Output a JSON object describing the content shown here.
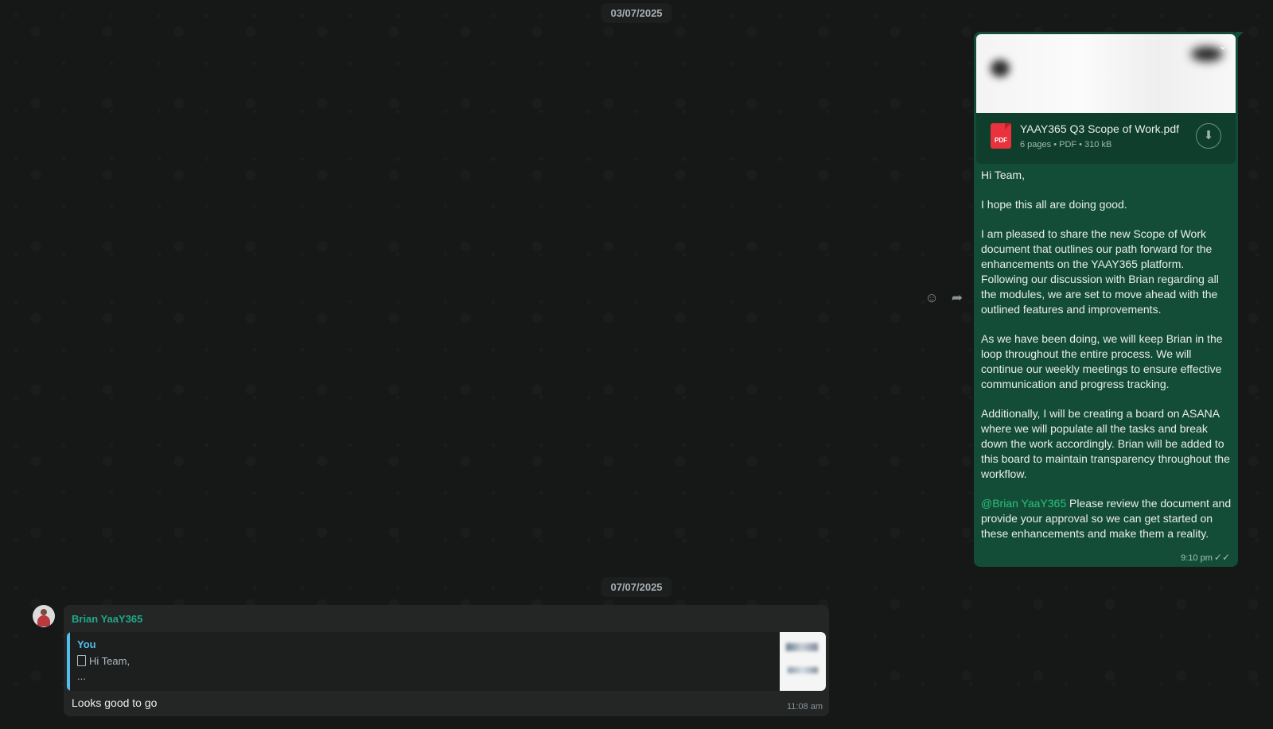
{
  "dates": {
    "first": "03/07/2025",
    "second": "07/07/2025"
  },
  "outgoing": {
    "file": {
      "name": "YAAY365 Q3 Scope of Work.pdf",
      "meta": "6 pages • PDF • 310 kB",
      "type_badge": "PDF"
    },
    "paragraphs": [
      "Hi Team,",
      "I hope this all are doing good.",
      "I am pleased to share the new Scope of Work document that outlines our path forward for the enhancements on the YAAY365 platform. Following our discussion with Brian regarding all the modules, we are set to move ahead with the outlined features and improvements.",
      "As we have been doing, we will keep Brian in the loop throughout the entire process. We will continue our weekly meetings to ensure effective communication and progress tracking.",
      "Additionally, I will be creating a board on ASANA where we will populate all the tasks and break down the work accordingly. Brian will be added to this board to maintain transparency throughout the workflow."
    ],
    "mention": "@Brian YaaY365",
    "last_paragraph": " Please review the document and provide your approval so we can get started on these enhancements and make them a reality.",
    "time": "9:10 pm"
  },
  "incoming": {
    "sender": "Brian YaaY365",
    "quote": {
      "author": "You",
      "line": "Hi Team,",
      "more": "..."
    },
    "text": "Looks good to go",
    "time": "11:08 am"
  },
  "icons": {
    "emoji": "emoji-icon",
    "forward": "forward-icon",
    "download": "download-icon",
    "chevron": "chevron-down-icon",
    "read_ticks": "double-check-icon"
  },
  "colors": {
    "background": "#161717",
    "outgoing_bubble": "#144d37",
    "incoming_bubble": "#242626",
    "mention": "#2bc07c",
    "quote_accent": "#53bdeb",
    "sender_name": "#1fa88a",
    "pdf_red": "#e9323d"
  }
}
